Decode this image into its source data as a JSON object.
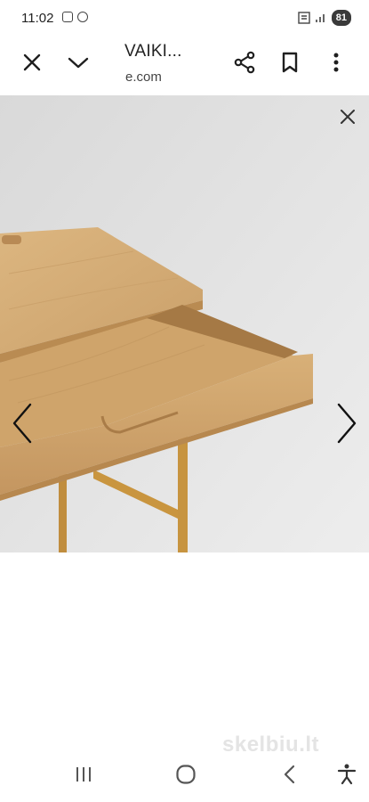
{
  "status_bar": {
    "time": "11:02",
    "battery": "81",
    "icons": [
      "screenshot-icon",
      "chrome-icon",
      "wifi-icon",
      "signal-icon",
      "battery-icon"
    ]
  },
  "toolbar": {
    "title": "VAIKI...",
    "url": "e.com",
    "icons": [
      "close-icon",
      "chevron-down-icon",
      "share-icon",
      "bookmark-icon",
      "more-vert-icon"
    ]
  },
  "viewer": {
    "image_subject": "wooden desk with open drawer",
    "icons": [
      "close-icon",
      "chevron-left-icon",
      "chevron-right-icon"
    ]
  },
  "watermark": "skelbiu.lt",
  "navbar": {
    "icons": [
      "recents-icon",
      "home-icon",
      "back-icon",
      "accessibility-icon"
    ]
  },
  "colors": {
    "background": "#ffffff",
    "photo_background": "#dfdfdf",
    "wood": "#d6ae78",
    "wood_dark": "#b98b52",
    "icon": "#1f1f1f"
  }
}
